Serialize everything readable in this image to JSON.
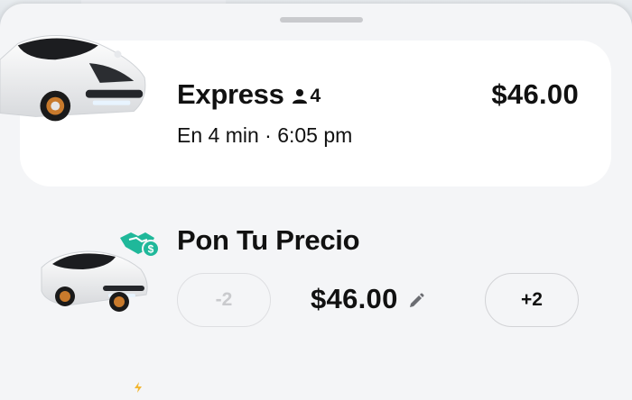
{
  "colors": {
    "accent_teal": "#1fb89a",
    "sheet_bg": "#f4f5f7",
    "card_bg": "#ffffff",
    "disabled_text": "#c9cacd"
  },
  "options": {
    "express": {
      "name": "Express",
      "seats": "4",
      "eta": "En 4 min · 6:05 pm",
      "price": "$46.00",
      "selected": true
    },
    "pon_tu_precio": {
      "name": "Pon Tu Precio",
      "price": "$46.00",
      "decrement_label": "-2",
      "increment_label": "+2",
      "decrement_enabled": false
    }
  },
  "icons": {
    "seat": "person-icon",
    "badge": "handshake-money-icon",
    "edit": "pencil-icon"
  }
}
